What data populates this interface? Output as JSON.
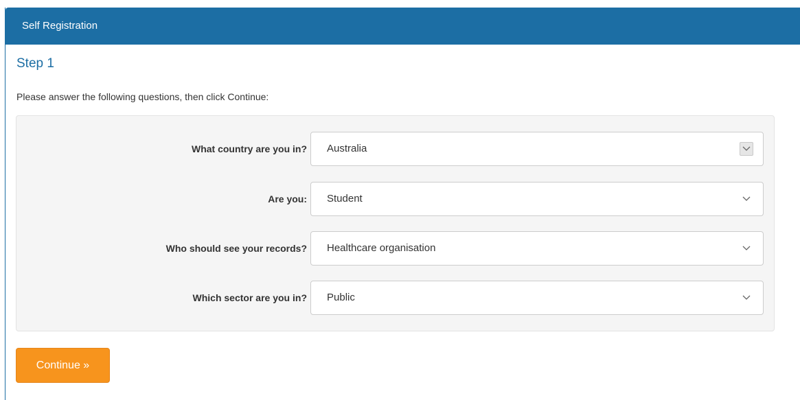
{
  "panel": {
    "title": "Self Registration"
  },
  "step": {
    "title": "Step 1",
    "intro": "Please answer the following questions, then click Continue:"
  },
  "form": {
    "fields": [
      {
        "label": "What country are you in?",
        "value": "Australia",
        "icon": "chevron-down-icon"
      },
      {
        "label": "Are you:",
        "value": "Student",
        "icon": "chevron-down-icon"
      },
      {
        "label": "Who should see your records?",
        "value": "Healthcare organisation",
        "icon": "chevron-down-icon"
      },
      {
        "label": "Which sector are you in?",
        "value": "Public",
        "icon": "chevron-down-icon"
      }
    ]
  },
  "actions": {
    "continue_label": "Continue »"
  },
  "colors": {
    "header_blue": "#1c6ea4",
    "accent_orange": "#f7941d"
  }
}
